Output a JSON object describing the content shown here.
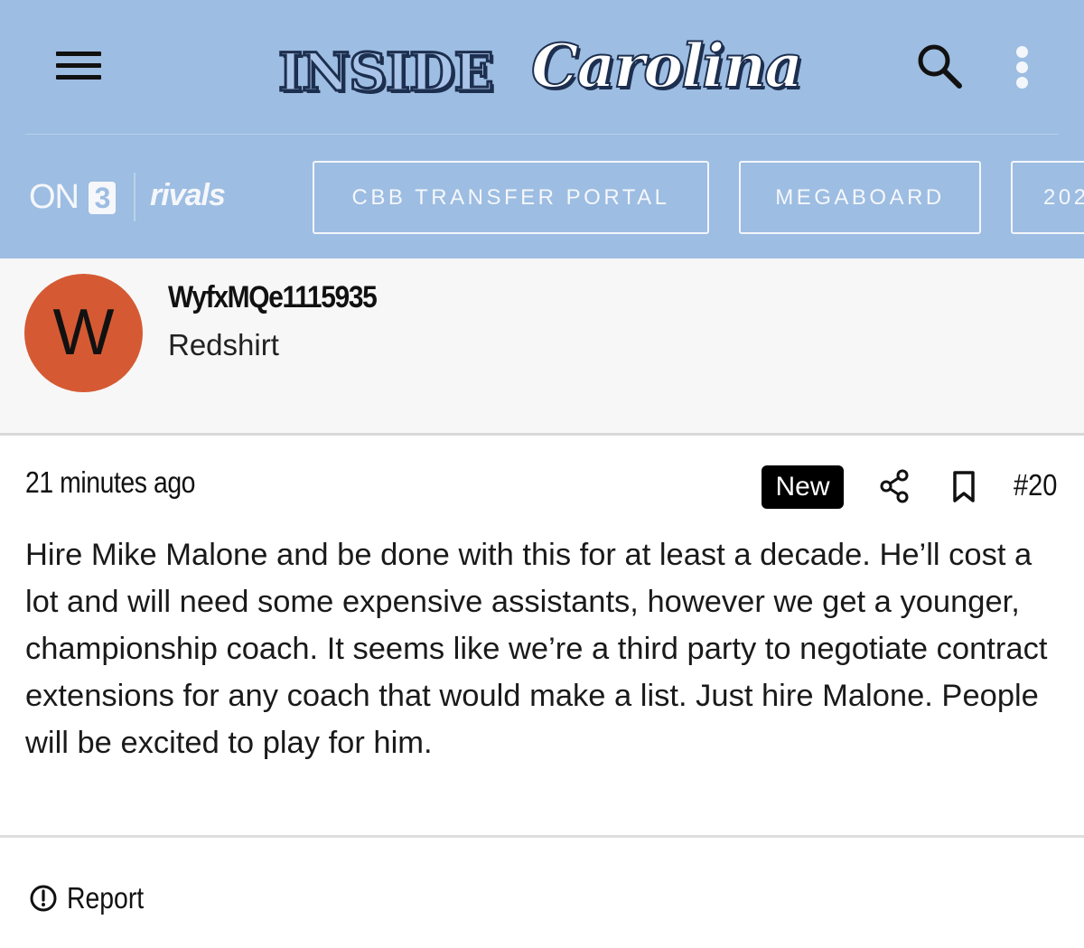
{
  "header": {
    "menu_icon": "hamburger-menu-icon",
    "logo": {
      "word1": "INSIDE",
      "word2": "Carolina"
    },
    "search_icon": "search-icon",
    "more_icon": "more-vertical-icon",
    "background_color": "#9dbde2"
  },
  "nav": {
    "brand_on3": "ON",
    "brand_on3_digit": "3",
    "brand_rivals": "rivals",
    "pills": [
      {
        "label": "CBB TRANSFER PORTAL"
      },
      {
        "label": "MEGABOARD"
      },
      {
        "label": "202"
      }
    ]
  },
  "author": {
    "avatar_letter": "W",
    "avatar_color": "#d55a33",
    "username": "WyfxMQe1115935",
    "rank": "Redshirt"
  },
  "post": {
    "timestamp": "21 minutes ago",
    "badge": "New",
    "share_icon": "share-icon",
    "bookmark_icon": "bookmark-icon",
    "number": "#20",
    "body": "Hire Mike Malone and be done with this for at least a decade. He’ll cost a lot and will need some expensive assistants, however we get a younger, championship coach. It seems like we’re a third party to negotiate contract extensions for any coach that would make a list. Just hire Malone. People will be excited to play for him."
  },
  "footer": {
    "report_icon": "alert-circle-icon",
    "report_label": "Report"
  }
}
